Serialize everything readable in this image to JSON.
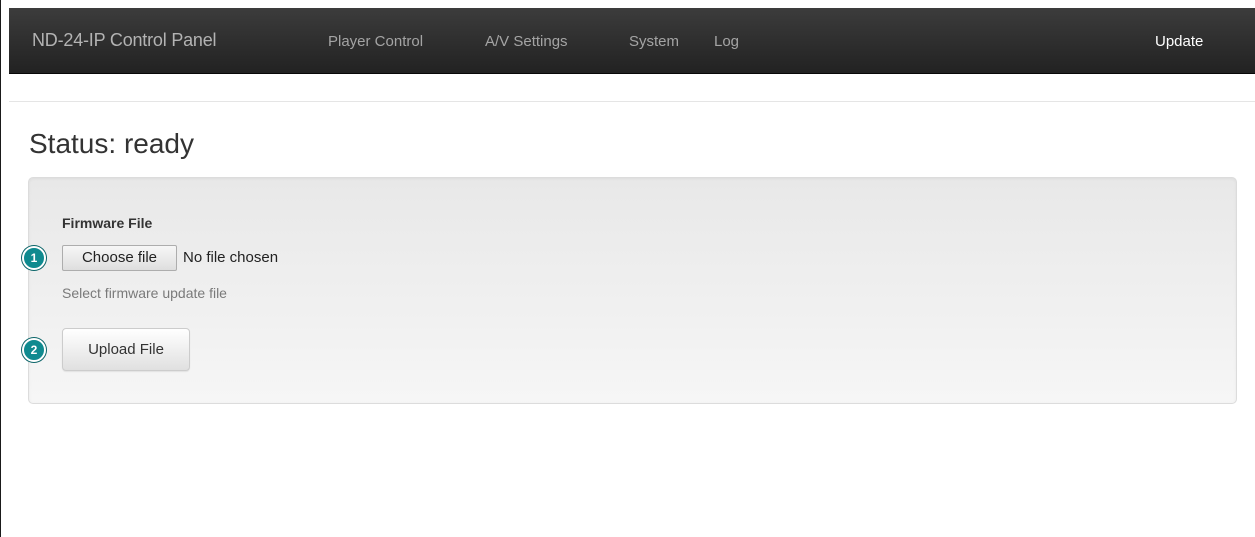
{
  "navbar": {
    "brand": "ND-24-IP Control Panel",
    "items": [
      {
        "label": "Player Control"
      },
      {
        "label": "A/V Settings"
      },
      {
        "label": "System"
      },
      {
        "label": "Log"
      }
    ],
    "right_item": {
      "label": "Update"
    }
  },
  "main": {
    "status": "Status: ready",
    "form": {
      "label": "Firmware File",
      "choose_button": "Choose file",
      "file_status": "No file chosen",
      "help_text": "Select firmware update file",
      "upload_button": "Upload File"
    }
  },
  "callouts": [
    "1",
    "2"
  ],
  "colors": {
    "navbar_bg": "#222222",
    "callout": "#0f8a8f"
  }
}
